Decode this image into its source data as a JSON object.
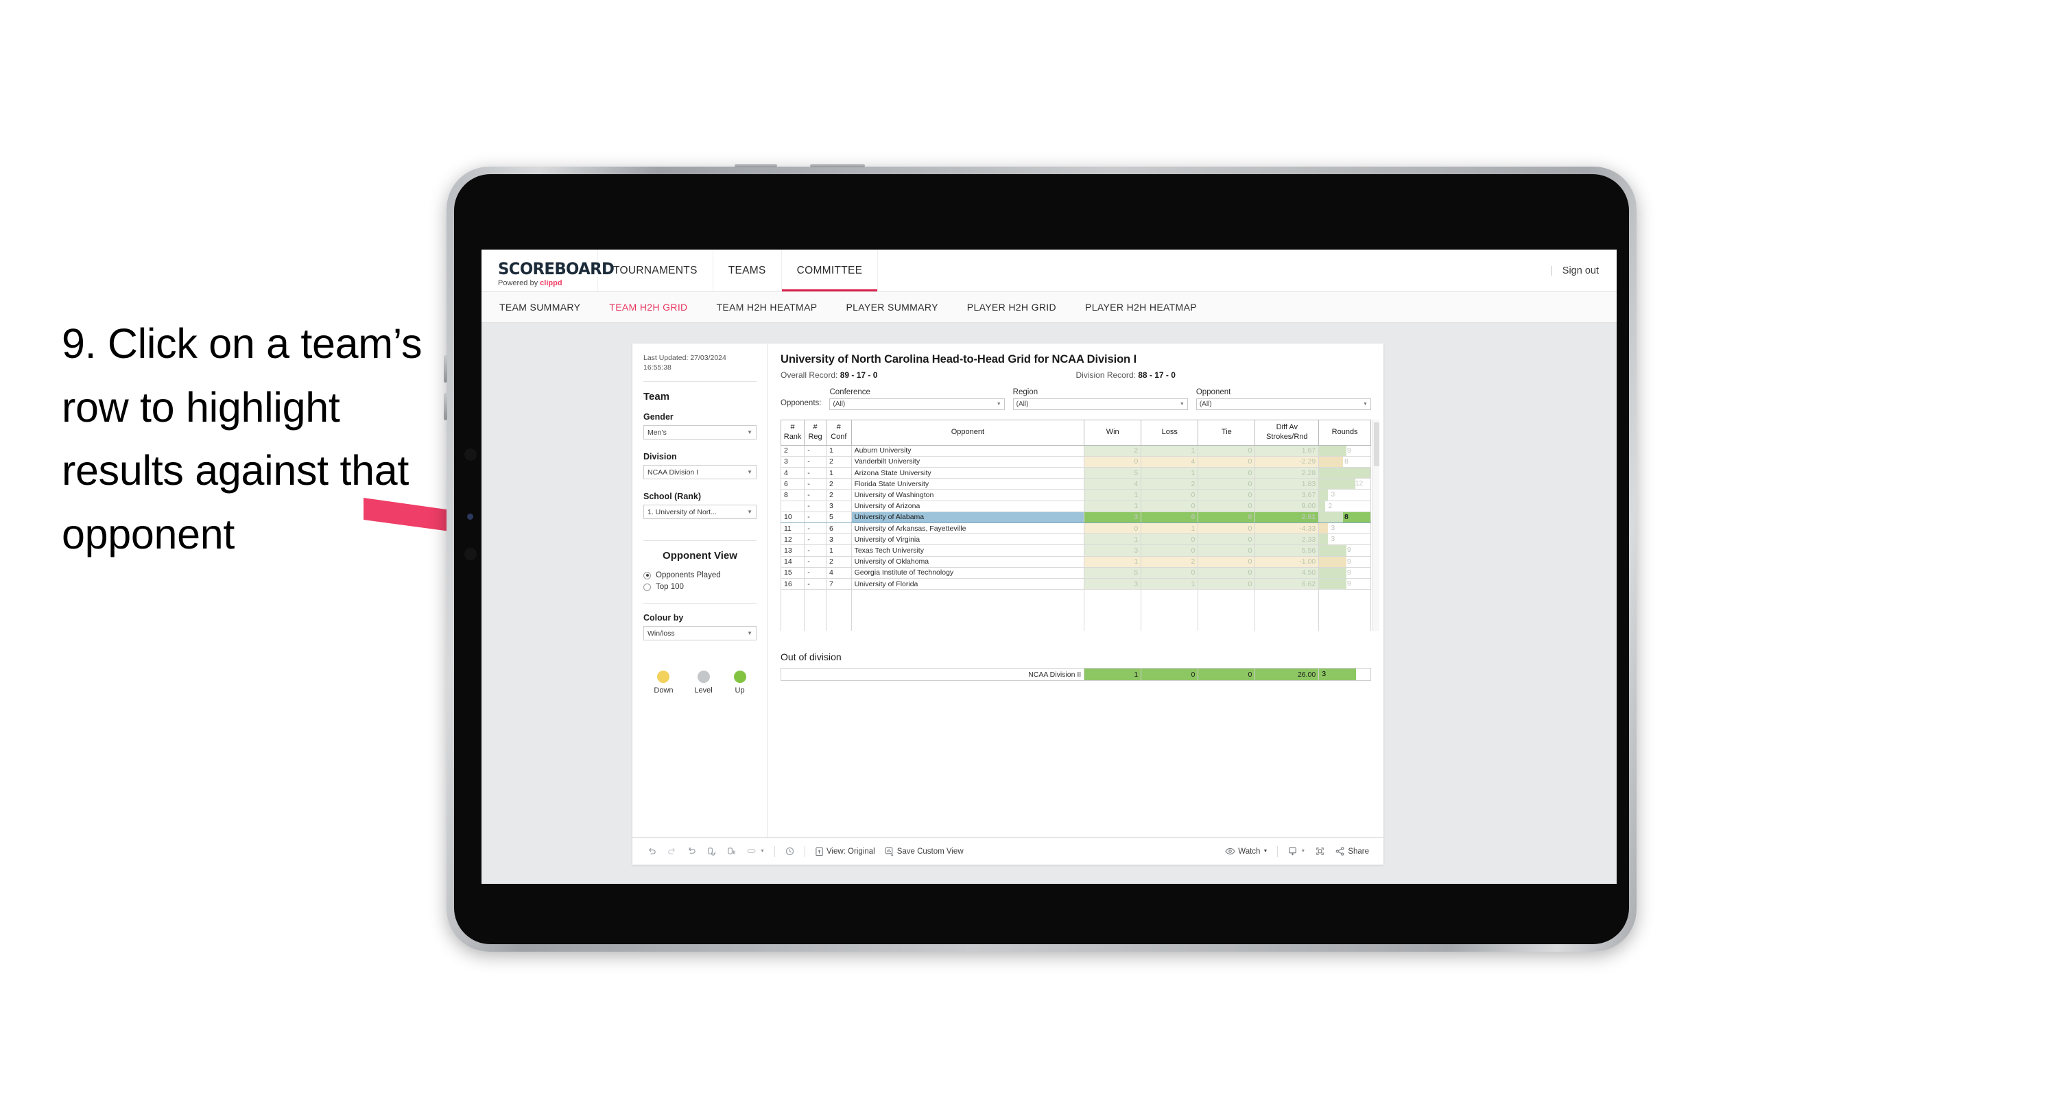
{
  "caption": "9. Click on a team’s row to highlight results against that opponent",
  "annotation": {
    "arrow_color": "#ef3e67"
  },
  "colors": {
    "accent_pink": "#d81f4a",
    "tab_active": "#e8375f",
    "win_green": "#e2ecd9",
    "loss_tan": "#f7edd2",
    "selected_row": "#9cc3d9",
    "selected_cell_green": "#8dc763",
    "legend_down": "#f2d15c",
    "legend_level": "#c4c7ca",
    "legend_up": "#82c341"
  },
  "topnav": {
    "brand_title": "SCOREBOARD",
    "brand_powered_prefix": "Powered by ",
    "brand_powered_name": "clippd",
    "tabs": [
      {
        "label": "TOURNAMENTS",
        "active": false
      },
      {
        "label": "TEAMS",
        "active": false
      },
      {
        "label": "COMMITTEE",
        "active": true
      }
    ],
    "separator": "|",
    "sign_out": "Sign out"
  },
  "subnav": {
    "items": [
      {
        "label": "TEAM SUMMARY",
        "active": false
      },
      {
        "label": "TEAM H2H GRID",
        "active": true
      },
      {
        "label": "TEAM H2H HEATMAP",
        "active": false
      },
      {
        "label": "PLAYER SUMMARY",
        "active": false
      },
      {
        "label": "PLAYER H2H GRID",
        "active": false
      },
      {
        "label": "PLAYER H2H HEATMAP",
        "active": false
      }
    ]
  },
  "sidebar": {
    "last_updated_label": "Last Updated:",
    "last_updated_date": "27/03/2024",
    "last_updated_time": "16:55:38",
    "team_heading": "Team",
    "gender_label": "Gender",
    "gender_value": "Men’s",
    "division_label": "Division",
    "division_value": "NCAA Division I",
    "school_label": "School (Rank)",
    "school_value": "1. University of Nort...",
    "opponent_view_heading": "Opponent View",
    "opponent_view_options": [
      {
        "label": "Opponents Played",
        "selected": true
      },
      {
        "label": "Top 100",
        "selected": false
      }
    ],
    "colour_by_label": "Colour by",
    "colour_by_value": "Win/loss",
    "legend": [
      {
        "label": "Down",
        "color": "#f2d15c"
      },
      {
        "label": "Level",
        "color": "#c4c7ca"
      },
      {
        "label": "Up",
        "color": "#82c341"
      }
    ]
  },
  "main": {
    "title": "University of North Carolina Head-to-Head Grid for NCAA Division I",
    "overall_record_label": "Overall Record:",
    "overall_record_value": "89 - 17 - 0",
    "division_record_label": "Division Record:",
    "division_record_value": "88 - 17 - 0",
    "opponents_label": "Opponents:",
    "filters": [
      {
        "label": "Conference",
        "value": "(All)"
      },
      {
        "label": "Region",
        "value": "(All)"
      },
      {
        "label": "Opponent",
        "value": "(All)"
      }
    ],
    "columns": [
      "# Rank",
      "# Reg",
      "# Conf",
      "Opponent",
      "Win",
      "Loss",
      "Tie",
      "Diff Av Strokes/Rnd",
      "Rounds"
    ],
    "rows": [
      {
        "rank": "2",
        "reg": "-",
        "conf": "1",
        "opponent": "Auburn University",
        "win": "2",
        "loss": "1",
        "tie": "0",
        "diff": "1.67",
        "rounds": "9",
        "state": "up",
        "selected": false
      },
      {
        "rank": "3",
        "reg": "-",
        "conf": "2",
        "opponent": "Vanderbilt University",
        "win": "0",
        "loss": "4",
        "tie": "0",
        "diff": "-2.29",
        "rounds": "8",
        "state": "down",
        "selected": false
      },
      {
        "rank": "4",
        "reg": "-",
        "conf": "1",
        "opponent": "Arizona State University",
        "win": "5",
        "loss": "1",
        "tie": "0",
        "diff": "2.28",
        "rounds": "17",
        "state": "up",
        "selected": false
      },
      {
        "rank": "6",
        "reg": "-",
        "conf": "2",
        "opponent": "Florida State University",
        "win": "4",
        "loss": "2",
        "tie": "0",
        "diff": "1.83",
        "rounds": "12",
        "state": "up",
        "selected": false
      },
      {
        "rank": "8",
        "reg": "-",
        "conf": "2",
        "opponent": "University of Washington",
        "win": "1",
        "loss": "0",
        "tie": "0",
        "diff": "3.67",
        "rounds": "3",
        "state": "up",
        "selected": false
      },
      {
        "rank": "",
        "reg": "-",
        "conf": "3",
        "opponent": "University of Arizona",
        "win": "1",
        "loss": "0",
        "tie": "0",
        "diff": "9.00",
        "rounds": "2",
        "state": "up",
        "selected": false
      },
      {
        "rank": "10",
        "reg": "-",
        "conf": "5",
        "opponent": "University of Alabama",
        "win": "3",
        "loss": "0",
        "tie": "0",
        "diff": "2.61",
        "rounds": "8",
        "state": "up",
        "selected": true
      },
      {
        "rank": "11",
        "reg": "-",
        "conf": "6",
        "opponent": "University of Arkansas, Fayetteville",
        "win": "0",
        "loss": "1",
        "tie": "0",
        "diff": "-4.33",
        "rounds": "3",
        "state": "down",
        "selected": false
      },
      {
        "rank": "12",
        "reg": "-",
        "conf": "3",
        "opponent": "University of Virginia",
        "win": "1",
        "loss": "0",
        "tie": "0",
        "diff": "2.33",
        "rounds": "3",
        "state": "up",
        "selected": false
      },
      {
        "rank": "13",
        "reg": "-",
        "conf": "1",
        "opponent": "Texas Tech University",
        "win": "3",
        "loss": "0",
        "tie": "0",
        "diff": "5.56",
        "rounds": "9",
        "state": "up",
        "selected": false
      },
      {
        "rank": "14",
        "reg": "-",
        "conf": "2",
        "opponent": "University of Oklahoma",
        "win": "1",
        "loss": "2",
        "tie": "0",
        "diff": "-1.00",
        "rounds": "9",
        "state": "down",
        "selected": false
      },
      {
        "rank": "15",
        "reg": "-",
        "conf": "4",
        "opponent": "Georgia Institute of Technology",
        "win": "5",
        "loss": "0",
        "tie": "0",
        "diff": "4.50",
        "rounds": "9",
        "state": "up",
        "selected": false
      },
      {
        "rank": "16",
        "reg": "-",
        "conf": "7",
        "opponent": "University of Florida",
        "win": "3",
        "loss": "1",
        "tie": "0",
        "diff": "6.62",
        "rounds": "9",
        "state": "up",
        "selected": false
      }
    ],
    "out_of_division_heading": "Out of division",
    "out_of_division_row": {
      "label": "NCAA Division II",
      "win": "1",
      "loss": "0",
      "tie": "0",
      "diff": "26.00",
      "rounds": "3"
    }
  },
  "toolbar": {
    "icons": [
      "undo-icon",
      "redo-icon",
      "revert-icon",
      "refresh-data-icon",
      "pause-refresh-icon",
      "swap-axes-icon"
    ],
    "view_label": "View: Original",
    "save_custom_view_label": "Save Custom View",
    "watch_label": "Watch",
    "share_label": "Share"
  },
  "chart_data": {
    "type": "table",
    "title": "University of North Carolina Head-to-Head Grid for NCAA Division I",
    "columns": [
      "# Rank",
      "# Reg",
      "# Conf",
      "Opponent",
      "Win",
      "Loss",
      "Tie",
      "Diff Av Strokes/Rnd",
      "Rounds"
    ],
    "rounds_axis_max": 17,
    "rows": [
      [
        "2",
        "-",
        "1",
        "Auburn University",
        2,
        1,
        0,
        1.67,
        9
      ],
      [
        "3",
        "-",
        "2",
        "Vanderbilt University",
        0,
        4,
        0,
        -2.29,
        8
      ],
      [
        "4",
        "-",
        "1",
        "Arizona State University",
        5,
        1,
        0,
        2.28,
        17
      ],
      [
        "6",
        "-",
        "2",
        "Florida State University",
        4,
        2,
        0,
        1.83,
        12
      ],
      [
        "8",
        "-",
        "2",
        "University of Washington",
        1,
        0,
        0,
        3.67,
        3
      ],
      [
        "",
        "-",
        "3",
        "University of Arizona",
        1,
        0,
        0,
        9.0,
        2
      ],
      [
        "10",
        "-",
        "5",
        "University of Alabama",
        3,
        0,
        0,
        2.61,
        8
      ],
      [
        "11",
        "-",
        "6",
        "University of Arkansas, Fayetteville",
        0,
        1,
        0,
        -4.33,
        3
      ],
      [
        "12",
        "-",
        "3",
        "University of Virginia",
        1,
        0,
        0,
        2.33,
        3
      ],
      [
        "13",
        "-",
        "1",
        "Texas Tech University",
        3,
        0,
        0,
        5.56,
        9
      ],
      [
        "14",
        "-",
        "2",
        "University of Oklahoma",
        1,
        2,
        0,
        -1.0,
        9
      ],
      [
        "15",
        "-",
        "4",
        "Georgia Institute of Technology",
        5,
        0,
        0,
        4.5,
        9
      ],
      [
        "16",
        "-",
        "7",
        "University of Florida",
        3,
        1,
        0,
        6.62,
        9
      ]
    ],
    "out_of_division": [
      [
        "NCAA Division II",
        1,
        0,
        0,
        26.0,
        3
      ]
    ]
  }
}
